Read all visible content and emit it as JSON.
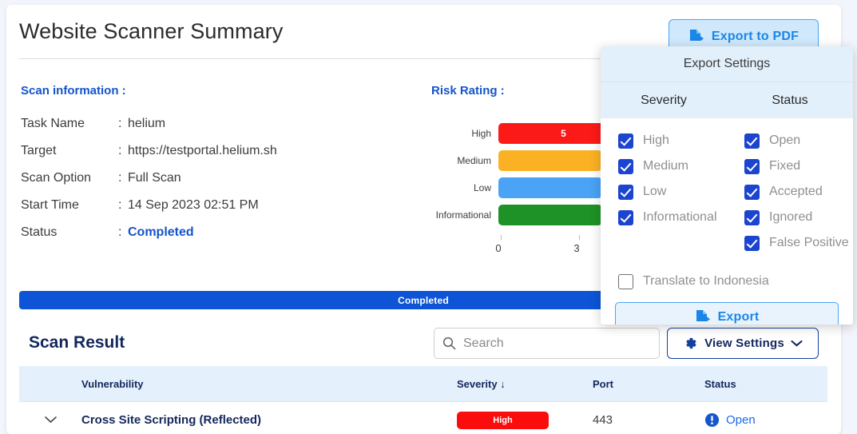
{
  "header": {
    "title": "Website Scanner Summary",
    "export_pdf_label": "Export to PDF",
    "export_pdf_icon": "file-export-icon"
  },
  "scan_information": {
    "heading": "Scan information :",
    "rows": [
      {
        "key": "Task Name",
        "sep": ":",
        "value": "helium"
      },
      {
        "key": "Target",
        "sep": ":",
        "value": "https://testportal.helium.sh"
      },
      {
        "key": "Scan Option",
        "sep": ":",
        "value": "Full Scan"
      },
      {
        "key": "Start Time",
        "sep": ":",
        "value": "14 Sep 2023 02:51 PM"
      },
      {
        "key": "Status",
        "sep": ":",
        "value": "Completed"
      }
    ]
  },
  "risk_rating": {
    "heading": "Risk Rating :"
  },
  "chart_data": {
    "type": "bar",
    "orientation": "horizontal",
    "title": "Risk Rating :",
    "categories": [
      "High",
      "Medium",
      "Low",
      "Informational"
    ],
    "values": [
      5,
      4,
      4,
      4
    ],
    "value_labels": [
      "5",
      "",
      "",
      ""
    ],
    "colors": [
      "#fb1a18",
      "#fbb124",
      "#4aa3f5",
      "#1e9226"
    ],
    "xlabel": "",
    "ylabel": "",
    "xlim": [
      0,
      6
    ],
    "xticks": [
      0,
      3
    ],
    "xtick_labels": [
      "0",
      "3"
    ],
    "grid": false,
    "legend": false,
    "note": "Bars extend behind the Export Settings popup; only the High bar value label (5) is visible."
  },
  "progress": {
    "label": "Completed",
    "percent": 100,
    "color": "#0d55d6"
  },
  "scan_result": {
    "title": "Scan Result",
    "search": {
      "placeholder": "Search",
      "value": "",
      "icon": "search-icon"
    },
    "view_settings": {
      "label": "View Settings",
      "icon": "gear-icon",
      "chevron": "chevron-down-icon"
    },
    "columns": {
      "expand": "",
      "vulnerability": "Vulnerability",
      "severity": "Severity",
      "severity_sort": "↓",
      "port": "Port",
      "status": "Status"
    },
    "rows": [
      {
        "expand_icon": "chevron-down-icon",
        "vulnerability": "Cross Site Scripting (Reflected)",
        "severity": "High",
        "severity_color": "#fb0d0d",
        "port": "443",
        "status": "Open",
        "status_icon": "alert-circle-icon"
      }
    ]
  },
  "export_settings_popup": {
    "title": "Export Settings",
    "col_severity": "Severity",
    "col_status": "Status",
    "severity_options": [
      {
        "label": "High",
        "checked": true
      },
      {
        "label": "Medium",
        "checked": true
      },
      {
        "label": "Low",
        "checked": true
      },
      {
        "label": "Informational",
        "checked": true
      }
    ],
    "status_options": [
      {
        "label": "Open",
        "checked": true
      },
      {
        "label": "Fixed",
        "checked": true
      },
      {
        "label": "Accepted",
        "checked": true
      },
      {
        "label": "Ignored",
        "checked": true
      },
      {
        "label": "False Positive",
        "checked": true
      }
    ],
    "translate": {
      "label": "Translate to Indonesia",
      "checked": false
    },
    "export_button": {
      "label": "Export",
      "icon": "file-export-icon"
    }
  },
  "colors": {
    "accent_blue": "#1554c9",
    "link_blue": "#1a6ae8",
    "dark_navy": "#13275c",
    "page_bg": "#f2f5fb"
  }
}
